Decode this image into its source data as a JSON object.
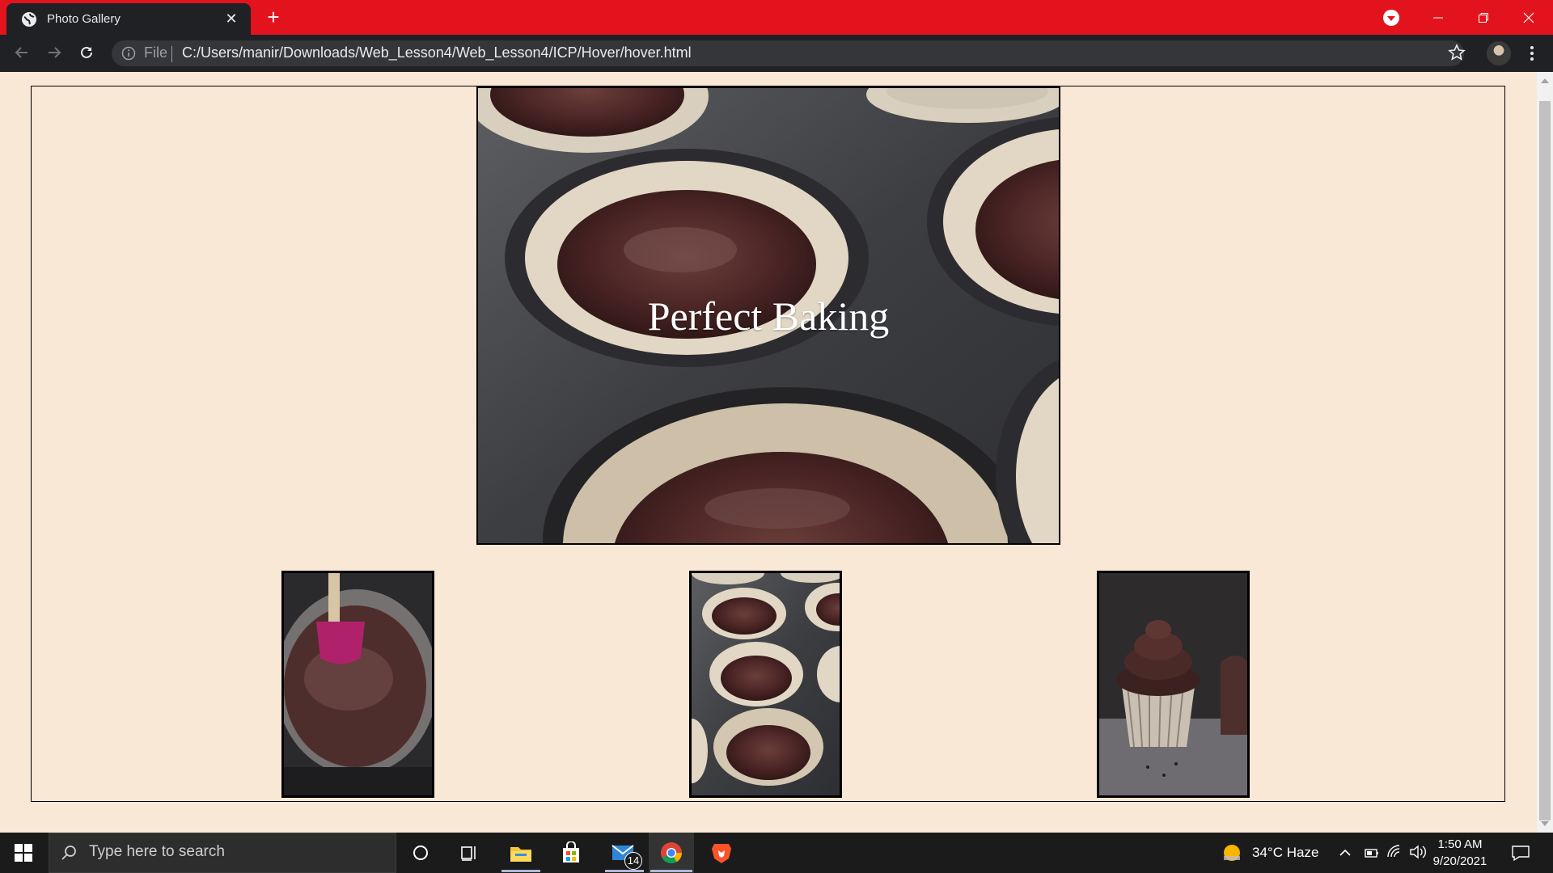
{
  "browser": {
    "tab_title": "Photo Gallery",
    "omnibox_scheme_label": "File",
    "url": "C:/Users/manir/Downloads/Web_Lesson4/Web_Lesson4/ICP/Hover/hover.html",
    "tab_color": "#e3131d"
  },
  "page": {
    "background": "#f9e8d6",
    "main_photo_caption": "Perfect Baking",
    "thumbnails": [
      {
        "subject": "chocolate batter in bowl"
      },
      {
        "subject": "cupcake pan with batter"
      },
      {
        "subject": "frosted chocolate cupcake"
      }
    ]
  },
  "taskbar": {
    "search_placeholder": "Type here to search",
    "mail_badge": "14",
    "weather": "34°C  Haze",
    "time": "1:50 AM",
    "date": "9/20/2021"
  }
}
